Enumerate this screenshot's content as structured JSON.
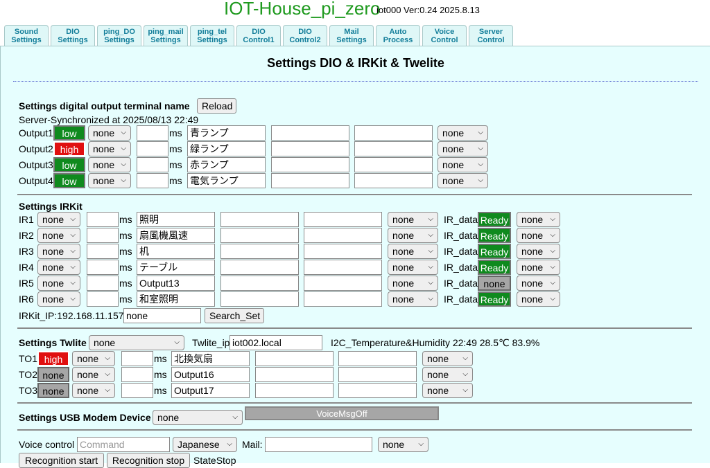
{
  "header": {
    "title": "IOT-House_pi_zero",
    "subtitle": "iot000  Ver:0.24 2025.8.13"
  },
  "tabs": [
    {
      "label": "Sound\nSettings"
    },
    {
      "label": "DIO\nSettings"
    },
    {
      "label": "ping_DO\nSettings"
    },
    {
      "label": "ping_mail\nSettings"
    },
    {
      "label": "ping_tel\nSettings"
    },
    {
      "label": "DIO\nControl1"
    },
    {
      "label": "DIO\nControl2"
    },
    {
      "label": "Mail\nSettings"
    },
    {
      "label": "Auto\nProcess"
    },
    {
      "label": "Voice\nControl"
    },
    {
      "label": "Server\nControl"
    }
  ],
  "page": {
    "title": "Settings DIO & IRKit & Twelite"
  },
  "dio": {
    "title": "Settings digital output terminal name",
    "reload": "Reload",
    "sync": "Server-Synchronized at 2025/08/13 22:49",
    "ms": "ms",
    "rows": [
      {
        "label": "Output1",
        "state": "low",
        "sel": "none",
        "name": "青ランプ",
        "sel2": "none"
      },
      {
        "label": "Output2",
        "state": "high",
        "sel": "none",
        "name": "緑ランプ",
        "sel2": "none"
      },
      {
        "label": "Output3",
        "state": "low",
        "sel": "none",
        "name": "赤ランプ",
        "sel2": "none"
      },
      {
        "label": "Output4",
        "state": "low",
        "sel": "none",
        "name": "電気ランプ",
        "sel2": "none"
      }
    ]
  },
  "irkit": {
    "title": "Settings IRKit",
    "ms": "ms",
    "ir_label": "IR_data",
    "rows": [
      {
        "label": "IR1",
        "sel": "none",
        "name": "照明",
        "sel2": "none",
        "status": "Ready",
        "sel3": "none"
      },
      {
        "label": "IR2",
        "sel": "none",
        "name": "扇風機風速",
        "sel2": "none",
        "status": "Ready",
        "sel3": "none"
      },
      {
        "label": "IR3",
        "sel": "none",
        "name": "机",
        "sel2": "none",
        "status": "Ready",
        "sel3": "none"
      },
      {
        "label": "IR4",
        "sel": "none",
        "name": "テーブル",
        "sel2": "none",
        "status": "Ready",
        "sel3": "none"
      },
      {
        "label": "IR5",
        "sel": "none",
        "name": "Output13",
        "sel2": "none",
        "status": "none",
        "sel3": "none"
      },
      {
        "label": "IR6",
        "sel": "none",
        "name": "和室照明",
        "sel2": "none",
        "status": "Ready",
        "sel3": "none"
      }
    ],
    "ip_label": "IRKit_IP:192.168.11.157",
    "ip_value": "none",
    "search": "Search_Set"
  },
  "twlite": {
    "title": "Settings Twlite",
    "sel": "none",
    "ip_label": "Twlite_ip",
    "ip_value": "iot002.local",
    "i2c": "I2C_Temperature&Humidity 22:49 28.5℃ 83.9%",
    "ms": "ms",
    "rows": [
      {
        "label": "TO1",
        "state": "high",
        "sel": "none",
        "name": "北換気扇",
        "sel2": "none"
      },
      {
        "label": "TO2",
        "state": "none",
        "sel": "none",
        "name": "Output16",
        "sel2": "none"
      },
      {
        "label": "TO3",
        "state": "none",
        "sel": "none",
        "name": "Output17",
        "sel2": "none"
      }
    ]
  },
  "usb": {
    "title": "Settings USB Modem Device",
    "sel": "none"
  },
  "voice": {
    "label": "Voice control",
    "placeholder": "Command",
    "lang": "Japanese",
    "mail_label": "Mail:",
    "mail_sel": "none",
    "rec_start": "Recognition start",
    "rec_stop": "Recognition stop",
    "state": "StateStop",
    "msg": "VoiceMsgOff"
  }
}
